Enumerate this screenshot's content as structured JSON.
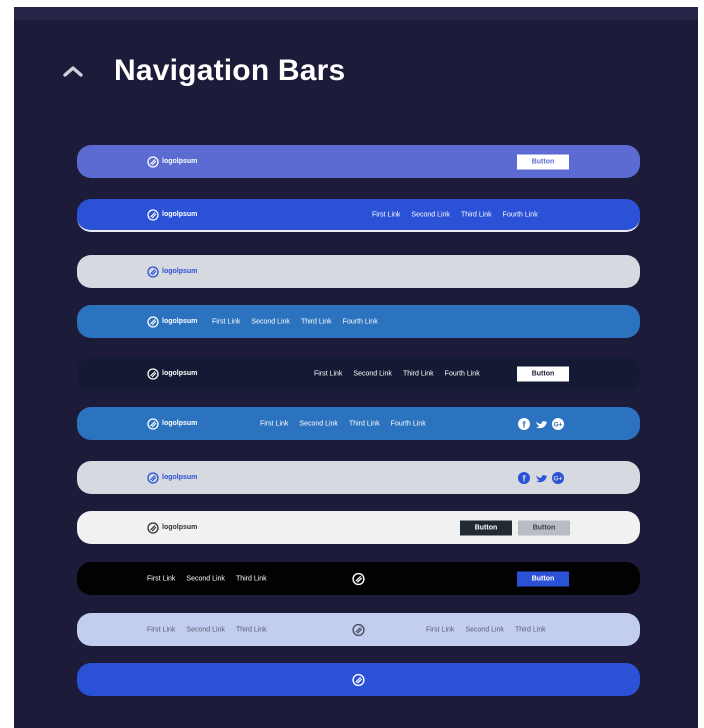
{
  "section": {
    "title": "Navigation Bars",
    "toggle_icon": "chevron-up-icon"
  },
  "logo_text": "logolpsum",
  "links": [
    "First Link",
    "Second Link",
    "Third Link",
    "Fourth Link"
  ],
  "button_label": "Button",
  "colors": {
    "panel": "#1c1b3a",
    "indigo": "#5c6bd2",
    "royal_blue": "#2a51d6",
    "light_gray": "#d6d9e0",
    "ocean_blue": "#2c73bf",
    "dark_navy": "#141a33",
    "off_white": "#f1f1f1",
    "black": "#020203",
    "periwinkle": "#c2cdef"
  },
  "social_icons": [
    "facebook-icon",
    "twitter-icon",
    "google-plus-icon"
  ]
}
